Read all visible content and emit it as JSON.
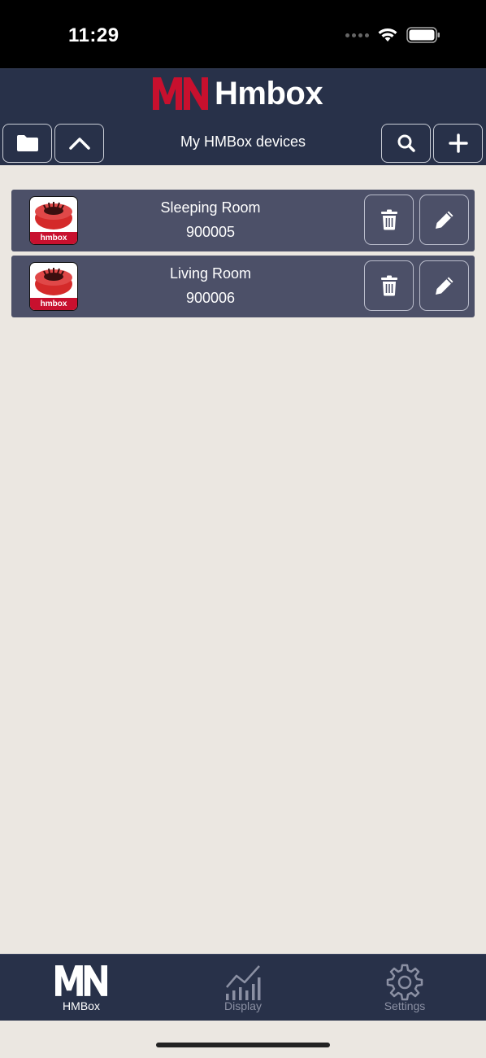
{
  "status": {
    "time": "11:29"
  },
  "header": {
    "logo_text": "Hmbox",
    "logo_mark": "MN",
    "title": "My HMBox devices",
    "brand_color": "#c8102e"
  },
  "devices": [
    {
      "name": "Sleeping Room",
      "id": "900005",
      "thumb_label": "hmbox"
    },
    {
      "name": "Living Room",
      "id": "900006",
      "thumb_label": "hmbox"
    }
  ],
  "tabs": [
    {
      "label": "HMBox",
      "icon": "mn-logo-icon",
      "active": true
    },
    {
      "label": "Display",
      "icon": "bar-chart-icon",
      "active": false
    },
    {
      "label": "Settings",
      "icon": "gear-icon",
      "active": false
    }
  ]
}
